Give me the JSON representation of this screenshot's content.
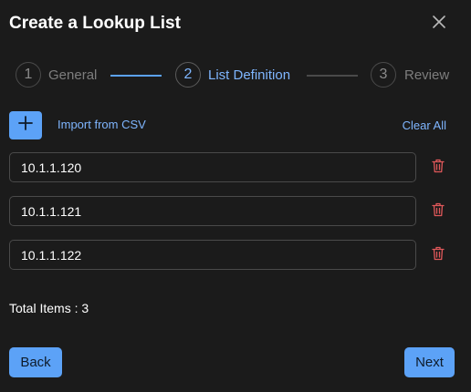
{
  "dialog": {
    "title": "Create a Lookup List"
  },
  "stepper": {
    "steps": [
      {
        "number": "1",
        "label": "General",
        "state": "complete"
      },
      {
        "number": "2",
        "label": "List Definition",
        "state": "active"
      },
      {
        "number": "3",
        "label": "Review",
        "state": "pending"
      }
    ]
  },
  "toolbar": {
    "add_icon": "plus-icon",
    "import_label": "Import from CSV",
    "clear_label": "Clear All"
  },
  "entries": [
    {
      "value": "10.1.1.120",
      "delete_icon": "trash-icon"
    },
    {
      "value": "10.1.1.121",
      "delete_icon": "trash-icon"
    },
    {
      "value": "10.1.1.122",
      "delete_icon": "trash-icon"
    }
  ],
  "total": {
    "text": "Total Items : 3"
  },
  "footer": {
    "back_label": "Back",
    "next_label": "Next"
  },
  "colors": {
    "background": "#1b1b1b",
    "accent": "#5ca2f7",
    "link": "#7fb6ff",
    "danger": "#e0585a"
  }
}
